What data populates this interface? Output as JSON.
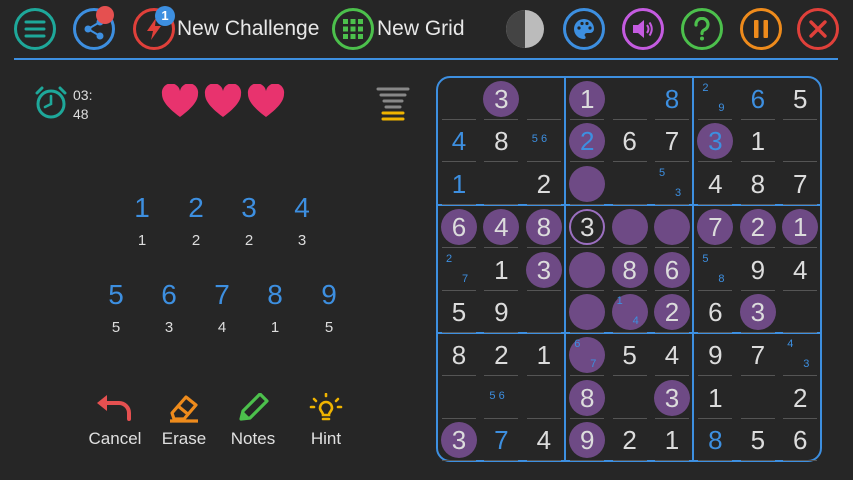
{
  "toolbar": {
    "share_badge_color": "#e55050",
    "challenge_badge": "1",
    "new_challenge_label": "New Challenge",
    "new_grid_label": "New Grid"
  },
  "status": {
    "timer": "03:\n48",
    "lives": 3
  },
  "numpad": [
    {
      "digit": "1",
      "count": "1"
    },
    {
      "digit": "2",
      "count": "2"
    },
    {
      "digit": "3",
      "count": "2"
    },
    {
      "digit": "4",
      "count": "3"
    },
    {
      "digit": "5",
      "count": "5"
    },
    {
      "digit": "6",
      "count": "3"
    },
    {
      "digit": "7",
      "count": "4"
    },
    {
      "digit": "8",
      "count": "1"
    },
    {
      "digit": "9",
      "count": "5"
    }
  ],
  "actions": {
    "cancel": "Cancel",
    "erase": "Erase",
    "notes": "Notes",
    "hint": "Hint"
  },
  "colors": {
    "accent": "#3d8fe0",
    "highlight": "#6e4a85",
    "heart": "#e8336e",
    "palette_orange": "#ee8b1c",
    "palette_purple": "#c45be0",
    "palette_green": "#4cc04c",
    "palette_red": "#e0403a"
  },
  "board": [
    [
      {
        "v": "",
        "h": 0
      },
      {
        "v": "3",
        "t": "g",
        "h": 1
      },
      {
        "v": "",
        "h": 0
      },
      {
        "v": "1",
        "t": "g",
        "h": 1
      },
      {
        "v": "",
        "h": 0
      },
      {
        "v": "8",
        "t": "u",
        "h": 0
      },
      {
        "n": [
          "2",
          "9"
        ],
        "h": 0
      },
      {
        "v": "6",
        "t": "u",
        "h": 0
      },
      {
        "v": "5",
        "t": "g",
        "h": 0
      }
    ],
    [
      {
        "v": "4",
        "t": "u",
        "h": 0
      },
      {
        "v": "8",
        "t": "g",
        "h": 0
      },
      {
        "n": [
          "5 6"
        ],
        "h": 0
      },
      {
        "v": "2",
        "t": "u",
        "h": 1
      },
      {
        "v": "6",
        "t": "g",
        "h": 0
      },
      {
        "v": "7",
        "t": "g",
        "h": 0
      },
      {
        "v": "3",
        "t": "u",
        "h": 1
      },
      {
        "v": "1",
        "t": "g",
        "h": 0
      },
      {
        "v": "",
        "h": 0
      }
    ],
    [
      {
        "v": "1",
        "t": "u",
        "h": 0
      },
      {
        "v": "",
        "h": 0
      },
      {
        "v": "2",
        "t": "g",
        "h": 0
      },
      {
        "v": "",
        "h": 1
      },
      {
        "v": "",
        "h": 0
      },
      {
        "n": [
          "5",
          "3"
        ],
        "h": 0
      },
      {
        "v": "4",
        "t": "g",
        "h": 0
      },
      {
        "v": "8",
        "t": "g",
        "h": 0
      },
      {
        "v": "7",
        "t": "g",
        "h": 0
      }
    ],
    [
      {
        "v": "6",
        "t": "g",
        "h": 1
      },
      {
        "v": "4",
        "t": "g",
        "h": 1
      },
      {
        "v": "8",
        "t": "g",
        "h": 1
      },
      {
        "v": "3",
        "t": "g",
        "h": 2
      },
      {
        "v": "",
        "h": 1
      },
      {
        "v": "",
        "h": 1
      },
      {
        "v": "7",
        "t": "g",
        "h": 1
      },
      {
        "v": "2",
        "t": "g",
        "h": 1
      },
      {
        "v": "1",
        "t": "g",
        "h": 1
      }
    ],
    [
      {
        "n": [
          "2",
          "7"
        ],
        "h": 0
      },
      {
        "v": "1",
        "t": "g",
        "h": 0
      },
      {
        "v": "3",
        "t": "g",
        "h": 1
      },
      {
        "v": "",
        "h": 1
      },
      {
        "v": "8",
        "t": "g",
        "h": 1
      },
      {
        "v": "6",
        "t": "g",
        "h": 1
      },
      {
        "n": [
          "5",
          "8"
        ],
        "h": 0
      },
      {
        "v": "9",
        "t": "g",
        "h": 0
      },
      {
        "v": "4",
        "t": "g",
        "h": 0
      }
    ],
    [
      {
        "v": "5",
        "t": "g",
        "h": 0
      },
      {
        "v": "9",
        "t": "g",
        "h": 0
      },
      {
        "v": "",
        "h": 0
      },
      {
        "v": "",
        "h": 1
      },
      {
        "n": [
          "1",
          "4"
        ],
        "h": 1
      },
      {
        "v": "2",
        "t": "g",
        "h": 1
      },
      {
        "v": "6",
        "t": "g",
        "h": 0
      },
      {
        "v": "3",
        "t": "g",
        "h": 1
      },
      {
        "v": "",
        "h": 0
      }
    ],
    [
      {
        "v": "8",
        "t": "g",
        "h": 0
      },
      {
        "v": "2",
        "t": "g",
        "h": 0
      },
      {
        "v": "1",
        "t": "g",
        "h": 0
      },
      {
        "n": [
          "6",
          "7"
        ],
        "h": 1
      },
      {
        "v": "5",
        "t": "g",
        "h": 0
      },
      {
        "v": "4",
        "t": "g",
        "h": 0
      },
      {
        "v": "9",
        "t": "g",
        "h": 0
      },
      {
        "v": "7",
        "t": "g",
        "h": 0
      },
      {
        "n": [
          "4",
          "3"
        ],
        "h": 0
      }
    ],
    [
      {
        "v": "",
        "h": 0
      },
      {
        "n": [
          "5 6"
        ],
        "h": 0
      },
      {
        "v": "",
        "h": 0
      },
      {
        "v": "8",
        "t": "g",
        "h": 1
      },
      {
        "v": "",
        "h": 0
      },
      {
        "v": "3",
        "t": "g",
        "h": 1
      },
      {
        "v": "1",
        "t": "g",
        "h": 0
      },
      {
        "v": "",
        "h": 0
      },
      {
        "v": "2",
        "t": "g",
        "h": 0
      }
    ],
    [
      {
        "v": "3",
        "t": "g",
        "h": 1
      },
      {
        "v": "7",
        "t": "u",
        "h": 0
      },
      {
        "v": "4",
        "t": "g",
        "h": 0
      },
      {
        "v": "9",
        "t": "g",
        "h": 1
      },
      {
        "v": "2",
        "t": "g",
        "h": 0
      },
      {
        "v": "1",
        "t": "g",
        "h": 0
      },
      {
        "v": "8",
        "t": "u",
        "h": 0
      },
      {
        "v": "5",
        "t": "g",
        "h": 0
      },
      {
        "v": "6",
        "t": "g",
        "h": 0
      }
    ]
  ]
}
